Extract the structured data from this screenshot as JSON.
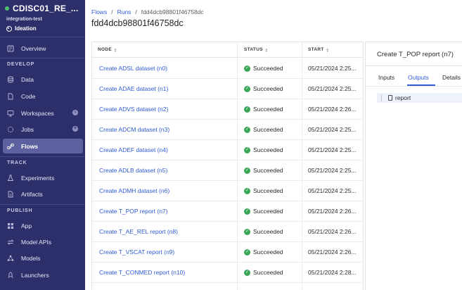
{
  "project": {
    "name": "CDISC01_RE_...",
    "org": "integration-test",
    "stage": "Ideation"
  },
  "sidebar": {
    "overview": "Overview",
    "sections": {
      "develop": "DEVELOP",
      "track": "TRACK",
      "publish": "PUBLISH"
    },
    "develop_items": [
      "Data",
      "Code",
      "Workspaces",
      "Jobs",
      "Flows"
    ],
    "track_items": [
      "Experiments",
      "Artifacts"
    ],
    "publish_items": [
      "App",
      "Model APIs",
      "Models",
      "Launchers"
    ],
    "active_item": "Flows"
  },
  "breadcrumb": {
    "flows": "Flows",
    "separator": "/",
    "runs": "Runs",
    "current": "fdd4dcb98801f46758dc"
  },
  "page_title": "fdd4dcb98801f46758dc",
  "table": {
    "headers": [
      "NODE",
      "STATUS",
      "START"
    ],
    "rows": [
      {
        "node": "Create ADSL dataset (n0)",
        "status": "Succeeded",
        "start": "05/21/2024 2:25..."
      },
      {
        "node": "Create ADAE dataset (n1)",
        "status": "Succeeded",
        "start": "05/21/2024 2:25..."
      },
      {
        "node": "Create ADVS dataset (n2)",
        "status": "Succeeded",
        "start": "05/21/2024 2:26..."
      },
      {
        "node": "Create ADCM dataset (n3)",
        "status": "Succeeded",
        "start": "05/21/2024 2:25..."
      },
      {
        "node": "Create ADEF dataset (n4)",
        "status": "Succeeded",
        "start": "05/21/2024 2:25..."
      },
      {
        "node": "Create ADLB dataset (n5)",
        "status": "Succeeded",
        "start": "05/21/2024 2:25..."
      },
      {
        "node": "Create ADMH dataset (n6)",
        "status": "Succeeded",
        "start": "05/21/2024 2:25..."
      },
      {
        "node": "Create T_POP report (n7)",
        "status": "Succeeded",
        "start": "05/21/2024 2:26..."
      },
      {
        "node": "Create T_AE_REL report (n8)",
        "status": "Succeeded",
        "start": "05/21/2024 2:26..."
      },
      {
        "node": "Create T_VSCAT report (n9)",
        "status": "Succeeded",
        "start": "05/21/2024 2:26..."
      },
      {
        "node": "Create T_CONMED report (n10)",
        "status": "Succeeded",
        "start": "05/21/2024 2:28..."
      }
    ]
  },
  "details": {
    "title": "Create T_POP report (n7)",
    "tabs": [
      "Inputs",
      "Outputs",
      "Details"
    ],
    "active_tab": "Outputs",
    "outputs": [
      "report"
    ]
  },
  "colors": {
    "sidebar_bg": "#2d2f6a",
    "sidebar_active": "#5e61a0",
    "link": "#2f5bd3",
    "success": "#3aa757",
    "project_status": "#4fc06a"
  }
}
